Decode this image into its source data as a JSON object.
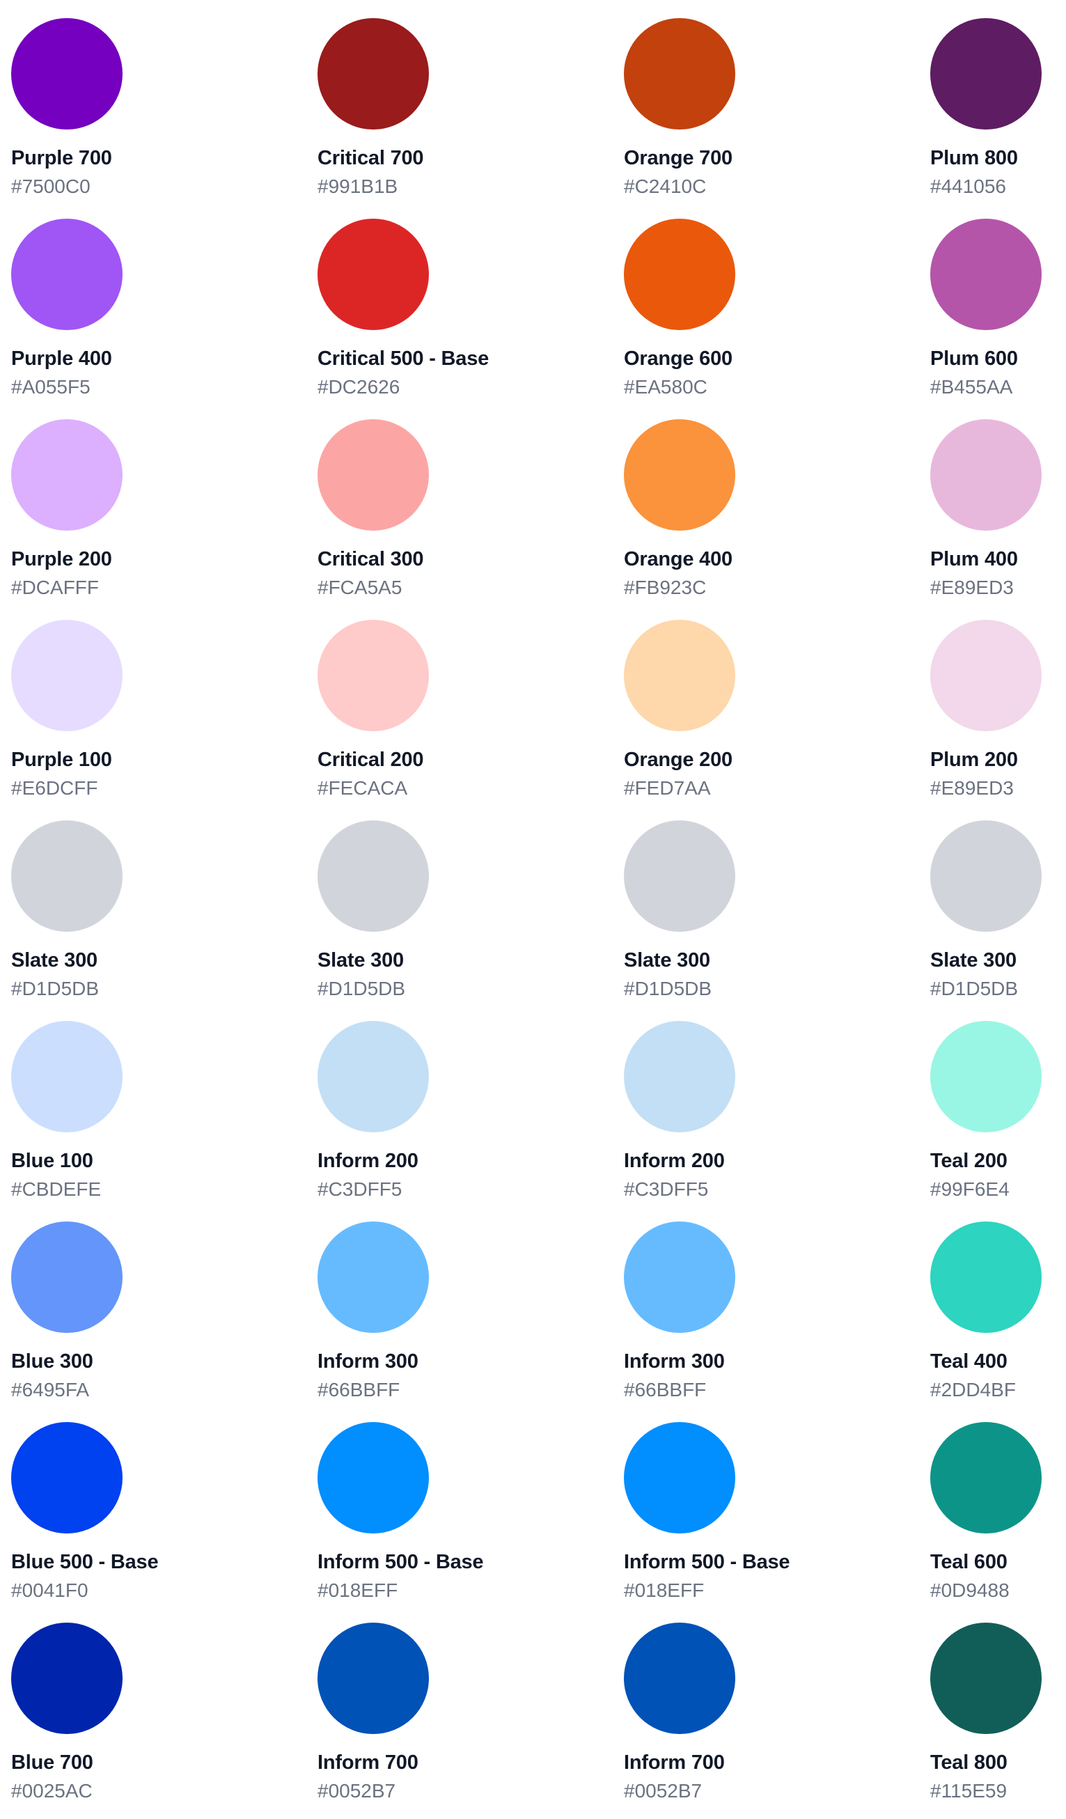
{
  "palette": {
    "columns": [
      {
        "swatches": [
          {
            "name": "Purple 700",
            "hex": "#7500C0",
            "color": "#7500C0"
          },
          {
            "name": "Purple 400",
            "hex": "#A055F5",
            "color": "#A055F5"
          },
          {
            "name": "Purple 200",
            "hex": "#DCAFFF",
            "color": "#DCAFFF"
          },
          {
            "name": "Purple 100",
            "hex": "#E6DCFF",
            "color": "#E6DCFF"
          },
          {
            "name": "Slate 300",
            "hex": "#D1D5DB",
            "color": "#D1D5DB"
          },
          {
            "name": "Blue 100",
            "hex": "#CBDEFE",
            "color": "#CBDEFE"
          },
          {
            "name": "Blue 300",
            "hex": "#6495FA",
            "color": "#6495FA"
          },
          {
            "name": "Blue 500 - Base",
            "hex": "#0041F0",
            "color": "#0041F0"
          },
          {
            "name": "Blue 700",
            "hex": "#0025AC",
            "color": "#0025AC"
          }
        ]
      },
      {
        "swatches": [
          {
            "name": "Critical 700",
            "hex": "#991B1B",
            "color": "#991B1B"
          },
          {
            "name": "Critical 500 - Base",
            "hex": "#DC2626",
            "color": "#DC2626"
          },
          {
            "name": "Critical 300",
            "hex": "#FCA5A5",
            "color": "#FCA5A5"
          },
          {
            "name": "Critical 200",
            "hex": "#FECACA",
            "color": "#FECACA"
          },
          {
            "name": "Slate 300",
            "hex": "#D1D5DB",
            "color": "#D1D5DB"
          },
          {
            "name": "Inform 200",
            "hex": "#C3DFF5",
            "color": "#C3DFF5"
          },
          {
            "name": "Inform 300",
            "hex": "#66BBFF",
            "color": "#66BBFF"
          },
          {
            "name": "Inform 500 - Base",
            "hex": "#018EFF",
            "color": "#018EFF"
          },
          {
            "name": "Inform 700",
            "hex": "#0052B7",
            "color": "#0052B7"
          }
        ]
      },
      {
        "swatches": [
          {
            "name": "Orange 700",
            "hex": "#C2410C",
            "color": "#C2410C"
          },
          {
            "name": "Orange 600",
            "hex": "#EA580C",
            "color": "#EA580C"
          },
          {
            "name": "Orange 400",
            "hex": "#FB923C",
            "color": "#FB923C"
          },
          {
            "name": "Orange 200",
            "hex": "#FED7AA",
            "color": "#FED7AA"
          },
          {
            "name": "Slate 300",
            "hex": "#D1D5DB",
            "color": "#D1D5DB"
          },
          {
            "name": "Inform 200",
            "hex": "#C3DFF5",
            "color": "#C3DFF5"
          },
          {
            "name": "Inform 300",
            "hex": "#66BBFF",
            "color": "#66BBFF"
          },
          {
            "name": "Inform 500 - Base",
            "hex": "#018EFF",
            "color": "#018EFF"
          },
          {
            "name": "Inform 700",
            "hex": "#0052B7",
            "color": "#0052B7"
          }
        ]
      },
      {
        "swatches": [
          {
            "name": "Plum 800",
            "hex": "#441056",
            "color": "#5E1C62"
          },
          {
            "name": "Plum 600",
            "hex": "#B455AA",
            "color": "#B455AA"
          },
          {
            "name": "Plum 400",
            "hex": "#E89ED3",
            "color": "#E8B8DC"
          },
          {
            "name": "Plum 200",
            "hex": "#E89ED3",
            "color": "#F2D8EA"
          },
          {
            "name": "Slate 300",
            "hex": "#D1D5DB",
            "color": "#D1D5DB"
          },
          {
            "name": "Teal 200",
            "hex": "#99F6E4",
            "color": "#99F6E4"
          },
          {
            "name": "Teal 400",
            "hex": "#2DD4BF",
            "color": "#2DD4BF"
          },
          {
            "name": "Teal 600",
            "hex": "#0D9488",
            "color": "#0D9488"
          },
          {
            "name": "Teal 800",
            "hex": "#115E59",
            "color": "#115E59"
          }
        ]
      }
    ]
  }
}
